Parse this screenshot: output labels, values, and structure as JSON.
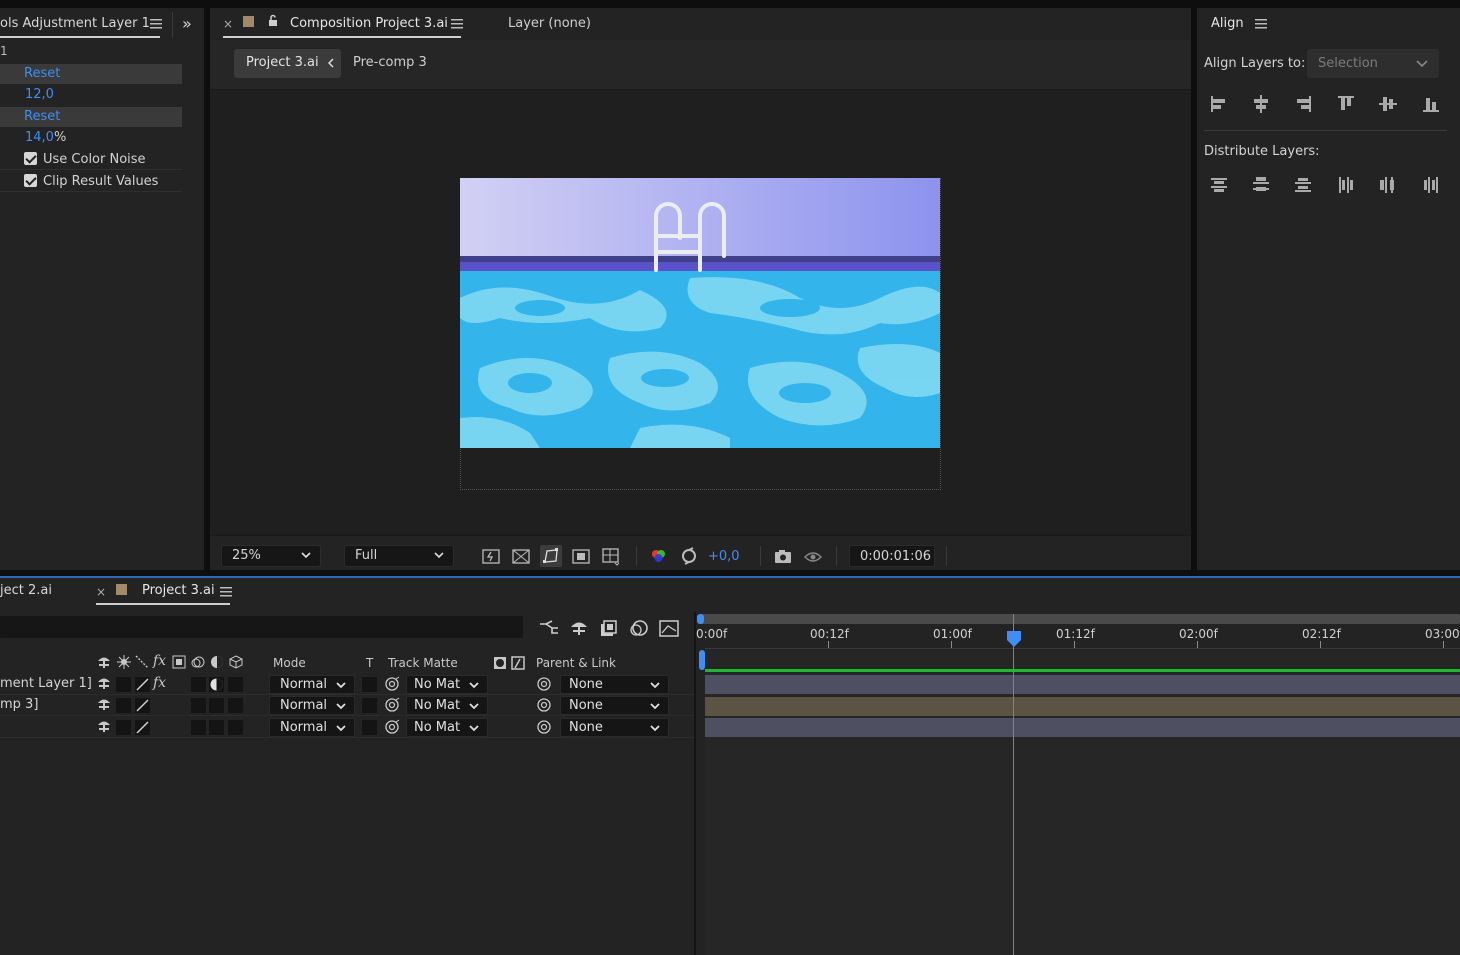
{
  "effect_controls": {
    "tab_title": "ols Adjustment Layer 1",
    "subtitle": "1",
    "rows": [
      {
        "label": "Reset"
      },
      {
        "label": "12,0"
      },
      {
        "label": "Reset"
      },
      {
        "label": "14,0",
        "suffix": "%"
      },
      {
        "label": "Use Color Noise"
      },
      {
        "label": "Clip Result Values"
      }
    ],
    "expand_glyph": "»"
  },
  "composition": {
    "close_glyph": "×",
    "tab_title": "Composition Project 3.ai",
    "layer_tab": "Layer (none)",
    "breadcrumb_active": "Project 3.ai",
    "breadcrumb_next": "Pre-comp 3",
    "zoom": "25%",
    "resolution": "Full",
    "exposure": "+0,0",
    "timecode": "0:00:01:06"
  },
  "align": {
    "title": "Align",
    "align_to_label": "Align Layers to:",
    "align_to_value": "Selection",
    "distribute_label": "Distribute Layers:"
  },
  "timeline": {
    "tab_prev": "ject 2.ai",
    "close_glyph": "×",
    "tab_active": "Project 3.ai",
    "col_mode": "Mode",
    "col_t": "T",
    "col_track_matte": "Track Matte",
    "col_parent": "Parent & Link",
    "layers": [
      {
        "name": "ment Layer 1]",
        "mode": "Normal",
        "matte": "No Mat",
        "parent": "None"
      },
      {
        "name": "mp 3]",
        "mode": "Normal",
        "matte": "No Mat",
        "parent": "None"
      },
      {
        "name": "",
        "mode": "Normal",
        "matte": "No Mat",
        "parent": "None"
      }
    ],
    "ruler": [
      "0:00f",
      "00:12f",
      "01:00f",
      "01:12f",
      "02:00f",
      "02:12f",
      "03:00f"
    ]
  },
  "colors": {
    "accent": "#3f8ef5",
    "panel_bg": "#232323",
    "track_green": "#21b634",
    "layer_bar_gray": "#4e4f60",
    "layer_bar_tan": "#5b5445"
  }
}
